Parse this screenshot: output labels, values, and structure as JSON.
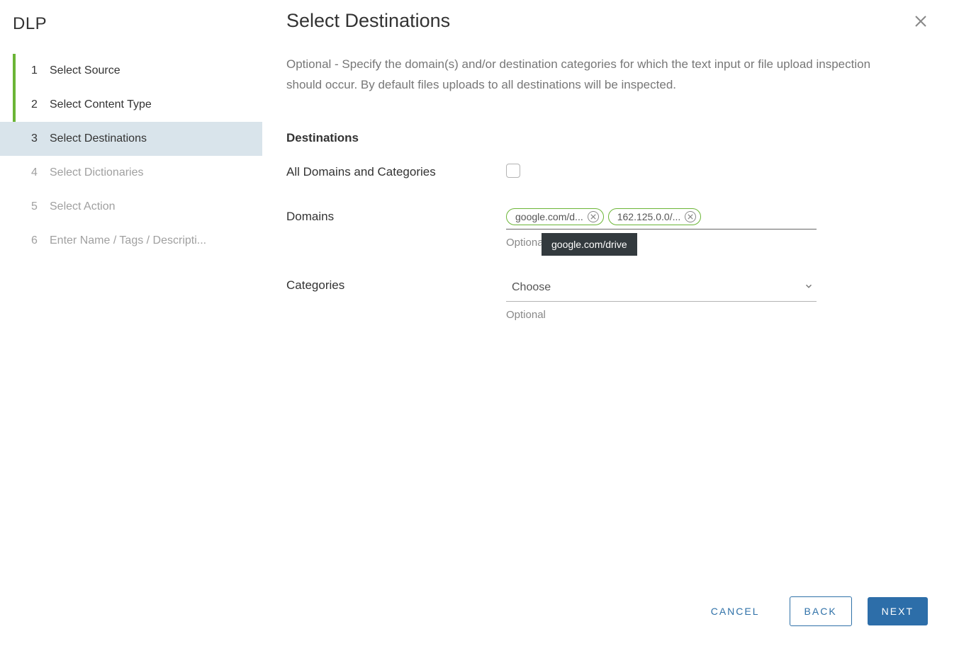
{
  "sidebar": {
    "title": "DLP",
    "steps": [
      {
        "number": "1",
        "label": "Select Source",
        "state": "completed"
      },
      {
        "number": "2",
        "label": "Select Content Type",
        "state": "completed"
      },
      {
        "number": "3",
        "label": "Select Destinations",
        "state": "active"
      },
      {
        "number": "4",
        "label": "Select Dictionaries",
        "state": "future"
      },
      {
        "number": "5",
        "label": "Select Action",
        "state": "future"
      },
      {
        "number": "6",
        "label": "Enter Name / Tags / Descripti...",
        "state": "future"
      }
    ]
  },
  "main": {
    "title": "Select Destinations",
    "description": "Optional - Specify the domain(s) and/or destination categories for which the text input or file upload inspection should occur. By default files uploads to all destinations will be inspected.",
    "section_destinations": "Destinations",
    "all_domains_label": "All Domains and Categories",
    "domains_label": "Domains",
    "domains_chips": [
      {
        "display": "google.com/d...",
        "full": "google.com/drive"
      },
      {
        "display": "162.125.0.0/...",
        "full": "162.125.0.0/..."
      }
    ],
    "domains_helper": "Optional",
    "categories_label": "Categories",
    "categories_placeholder": "Choose",
    "categories_helper": "Optional",
    "tooltip_text": "google.com/drive"
  },
  "footer": {
    "cancel": "CANCEL",
    "back": "BACK",
    "next": "NEXT"
  }
}
